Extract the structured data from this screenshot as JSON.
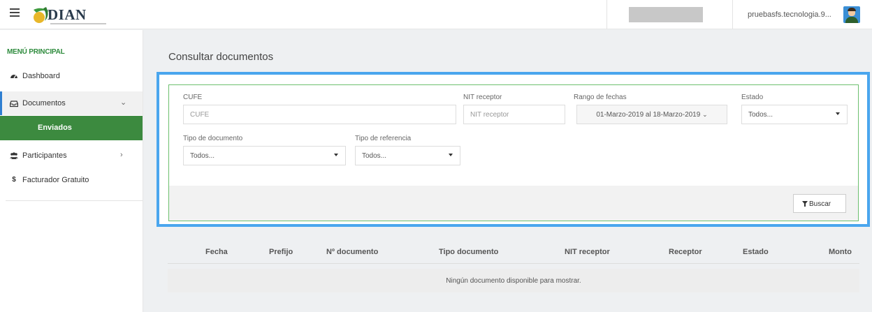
{
  "header": {
    "brand": "DIAN",
    "user_name": "pruebasfs.tecnologia.9..."
  },
  "sidebar": {
    "menu_title": "MENÚ PRINCIPAL",
    "items": [
      {
        "label": "Dashboard",
        "icon": "dashboard-icon"
      },
      {
        "label": "Documentos",
        "icon": "inbox-icon"
      },
      {
        "label": "Enviados"
      },
      {
        "label": "Participantes",
        "icon": "users-icon"
      },
      {
        "label": "Facturador Gratuito",
        "icon": "dollar-icon"
      }
    ],
    "dollar_glyph": "$"
  },
  "main": {
    "title": "Consultar documentos",
    "filters": {
      "cufe_label": "CUFE",
      "cufe_placeholder": "CUFE",
      "nit_label": "NIT receptor",
      "nit_placeholder": "NIT receptor",
      "date_label": "Rango de fechas",
      "date_value": "01-Marzo-2019 al 18-Marzo-2019",
      "estado_label": "Estado",
      "estado_value": "Todos...",
      "tipo_doc_label": "Tipo de documento",
      "tipo_doc_value": "Todos...",
      "tipo_ref_label": "Tipo de referencia",
      "tipo_ref_value": "Todos...",
      "search_button": "Buscar"
    },
    "table": {
      "columns": [
        "Fecha",
        "Prefijo",
        "Nº documento",
        "Tipo documento",
        "NIT receptor",
        "Receptor",
        "Estado",
        "Monto"
      ],
      "empty_message": "Ningún documento disponible para mostrar."
    }
  },
  "colors": {
    "accent_green": "#3c8a3f",
    "focus_blue": "#4aa6ee",
    "menu_title_green": "#2e8b3d"
  }
}
